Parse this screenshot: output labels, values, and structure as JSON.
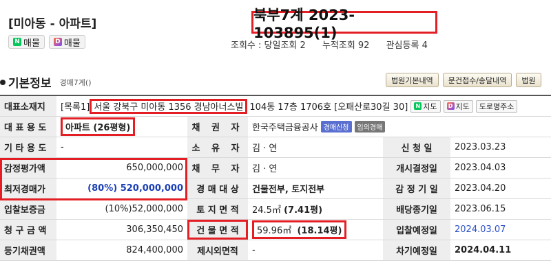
{
  "header": {
    "title": "[미아동 - 아파트]",
    "badge_naver": "매물",
    "badge_daum": "매물",
    "case_number": "북부7계 2023-103895(1)",
    "stats": {
      "views_label": "조회수",
      "views_value": "당일조회 2",
      "total_views": "누적조회 92",
      "interest": "관심등록 4"
    }
  },
  "section": {
    "title": "기본정보",
    "subtitle": "경매7계()",
    "buttons": [
      "법원기본내역",
      "문건접수/송달내역",
      "법원"
    ]
  },
  "address": {
    "label": "대표소재지",
    "prefix": "[목록1]",
    "main": "서울 강북구 미아동 1356 경남아너스빌",
    "detail": "104동 17층 1706호 [오패산로30길 30]",
    "btn_naver_map": "지도",
    "btn_daum_map": "지도",
    "btn_road_map": "도로명주소"
  },
  "rows": [
    {
      "l1": "대 표 용 도",
      "v1": "아파트 (26평형)",
      "l2": "채 권 자",
      "v2": "한국주택금융공사",
      "tag1": "경매신청",
      "tag2": "임의경매",
      "l3": "",
      "v3": ""
    },
    {
      "l1": "기 타 용 도",
      "v1": "-",
      "l2": "소 유 자",
      "v2": "김 · 연",
      "l3": "신 청 일",
      "v3": "2023.03.23"
    },
    {
      "l1": "감정평가액",
      "v1": "650,000,000",
      "l2": "채 무 자",
      "v2": "김 · 연",
      "l3": "개시결정일",
      "v3": "2023.04.03"
    },
    {
      "l1": "최저경매가",
      "v1_pct": "(80%)",
      "v1": "520,000,000",
      "l2": "경 매 대 상",
      "v2": "건물전부, 토지전부",
      "l3": "감 정 기 일",
      "v3": "2023.04.20"
    },
    {
      "l1": "입찰보증금",
      "v1": "(10%)52,000,000",
      "l2": "토 지 면 적",
      "v2": "24.5㎡",
      "v2b": "(7.41평)",
      "l3": "배당종기일",
      "v3": "2023.06.15"
    },
    {
      "l1": "청 구 금 액",
      "v1": "306,350,450",
      "l2": "건 물 면 적",
      "v2": "59.96㎡",
      "v2b": "(18.14평)",
      "l3": "입찰예정일",
      "v3": "2024.03.07"
    },
    {
      "l1": "등기채권액",
      "v1": "824,400,000",
      "l2": "제시외면적",
      "v2": "-",
      "l3": "차기예정일",
      "v3": "2024.04.11"
    }
  ]
}
